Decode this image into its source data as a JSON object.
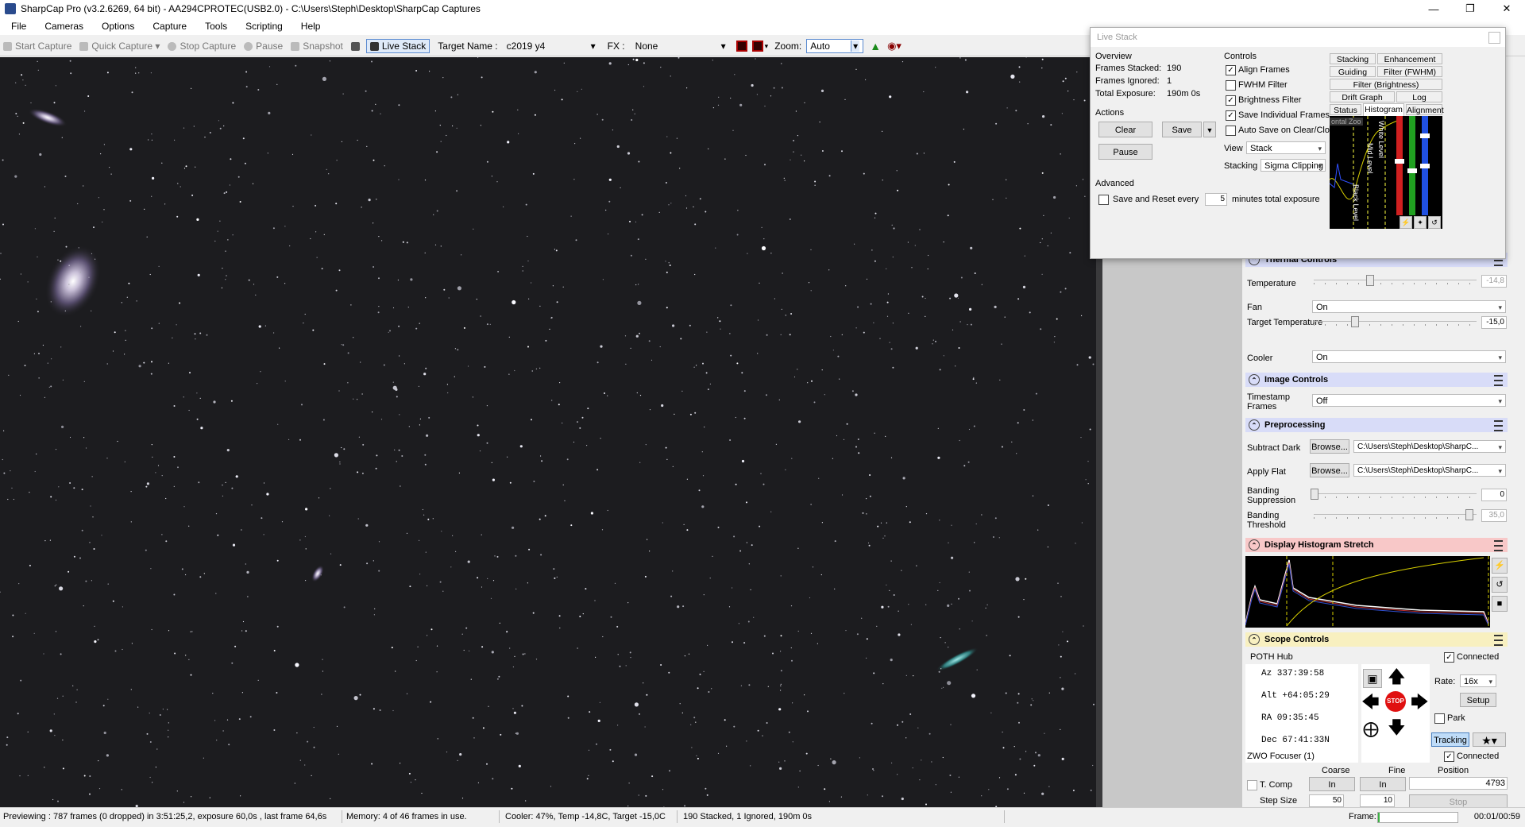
{
  "window": {
    "title": "SharpCap Pro (v3.2.6269, 64 bit) - AA294CPROTEC(USB2.0) - C:\\Users\\Steph\\Desktop\\SharpCap Captures"
  },
  "menu": [
    "File",
    "Cameras",
    "Options",
    "Capture",
    "Tools",
    "Scripting",
    "Help"
  ],
  "toolbar": {
    "start_capture": "Start Capture",
    "quick_capture": "Quick Capture",
    "stop_capture": "Stop Capture",
    "pause": "Pause",
    "snapshot": "Snapshot",
    "live_stack": "Live Stack",
    "target_label": "Target Name :",
    "target_value": "c2019 y4",
    "fx_label": "FX :",
    "fx_value": "None",
    "zoom_label": "Zoom:",
    "zoom_value": "Auto"
  },
  "livestack": {
    "title": "Live Stack",
    "overview_label": "Overview",
    "frames_stacked_label": "Frames Stacked:",
    "frames_stacked": "190",
    "frames_ignored_label": "Frames Ignored:",
    "frames_ignored": "1",
    "total_exposure_label": "Total Exposure:",
    "total_exposure": "190m 0s",
    "actions_label": "Actions",
    "clear": "Clear",
    "save": "Save",
    "pause": "Pause",
    "advanced_label": "Advanced",
    "save_reset_label": "Save and Reset every",
    "save_reset_value": "5",
    "save_reset_suffix": "minutes total exposure",
    "controls_label": "Controls",
    "align_frames": "Align Frames",
    "fwhm_filter": "FWHM Filter",
    "brightness_filter": "Brightness Filter",
    "save_individual": "Save Individual Frames",
    "auto_save": "Auto Save on Clear/Close",
    "view_label": "View",
    "view_value": "Stack",
    "stacking_label": "Stacking",
    "stacking_value": "Sigma Clipping",
    "tabs_row1": [
      "Stacking",
      "Enhancement"
    ],
    "tabs_row2": [
      "Guiding",
      "Filter (FWHM)"
    ],
    "tabs_row3": [
      "Filter (Brightness)"
    ],
    "tabs_row4": [
      "Drift Graph",
      "Log"
    ],
    "tabs_row5": [
      "Status",
      "Histogram",
      "Alignment"
    ],
    "hist_labels": {
      "white": "White Level",
      "mid": "Mid Level",
      "black": "Black Level",
      "horiz": "ontal Zoo"
    }
  },
  "thermal": {
    "title": "Thermal Controls",
    "temperature_label": "Temperature",
    "temperature_value": "-14,8",
    "temperature_level": 0.34,
    "fan_label": "Fan",
    "fan_value": "On",
    "target_temp_label": "Target Temperature",
    "target_temp_value": "-15,0",
    "target_temp_level": 0.25,
    "cooler_label": "Cooler",
    "cooler_value": "On"
  },
  "image_controls": {
    "title": "Image Controls",
    "timestamp_label": "Timestamp Frames",
    "timestamp_value": "Off"
  },
  "preprocessing": {
    "title": "Preprocessing",
    "subtract_dark_label": "Subtract Dark",
    "apply_flat_label": "Apply Flat",
    "browse": "Browse...",
    "dark_path": "C:\\Users\\Steph\\Desktop\\SharpC...",
    "flat_path": "C:\\Users\\Steph\\Desktop\\SharpC...",
    "banding_supp_label": "Banding Suppression",
    "banding_supp_value": "0",
    "banding_supp_level": 0.0,
    "banding_thresh_label": "Banding Threshold",
    "banding_thresh_value": "35,0",
    "banding_thresh_level": 0.95
  },
  "histogram_stretch": {
    "title": "Display Histogram Stretch"
  },
  "scope": {
    "title": "Scope Controls",
    "mount_name": "POTH Hub",
    "connected": "Connected",
    "az": "Az   337:39:58",
    "alt": "Alt  +64:05:29",
    "ra": "RA   09:35:45",
    "dec": "Dec  67:41:33N",
    "rate_label": "Rate:",
    "rate_value": "16x",
    "stop": "STOP",
    "setup": "Setup",
    "park": "Park",
    "tracking": "Tracking"
  },
  "focuser": {
    "name": "ZWO Focuser (1)",
    "connected": "Connected",
    "coarse": "Coarse",
    "fine": "Fine",
    "position": "Position",
    "tcomp": "T. Comp",
    "in_coarse": "In",
    "in_fine": "In",
    "position_value": "4793",
    "step_size": "Step Size",
    "coarse_step": "50",
    "fine_step": "10",
    "stop": "Stop"
  },
  "status": {
    "preview": "Previewing : 787 frames (0 dropped) in 3:51:25,2, exposure 60,0s , last frame 64,6s",
    "memory": "Memory: 4 of 46 frames in use.",
    "cooler": "Cooler: 47%, Temp -14,8C, Target -15,0C",
    "stacked": "190 Stacked, 1 Ignored, 190m 0s",
    "frame_label": "Frame:",
    "time": "00:01/00:59"
  }
}
